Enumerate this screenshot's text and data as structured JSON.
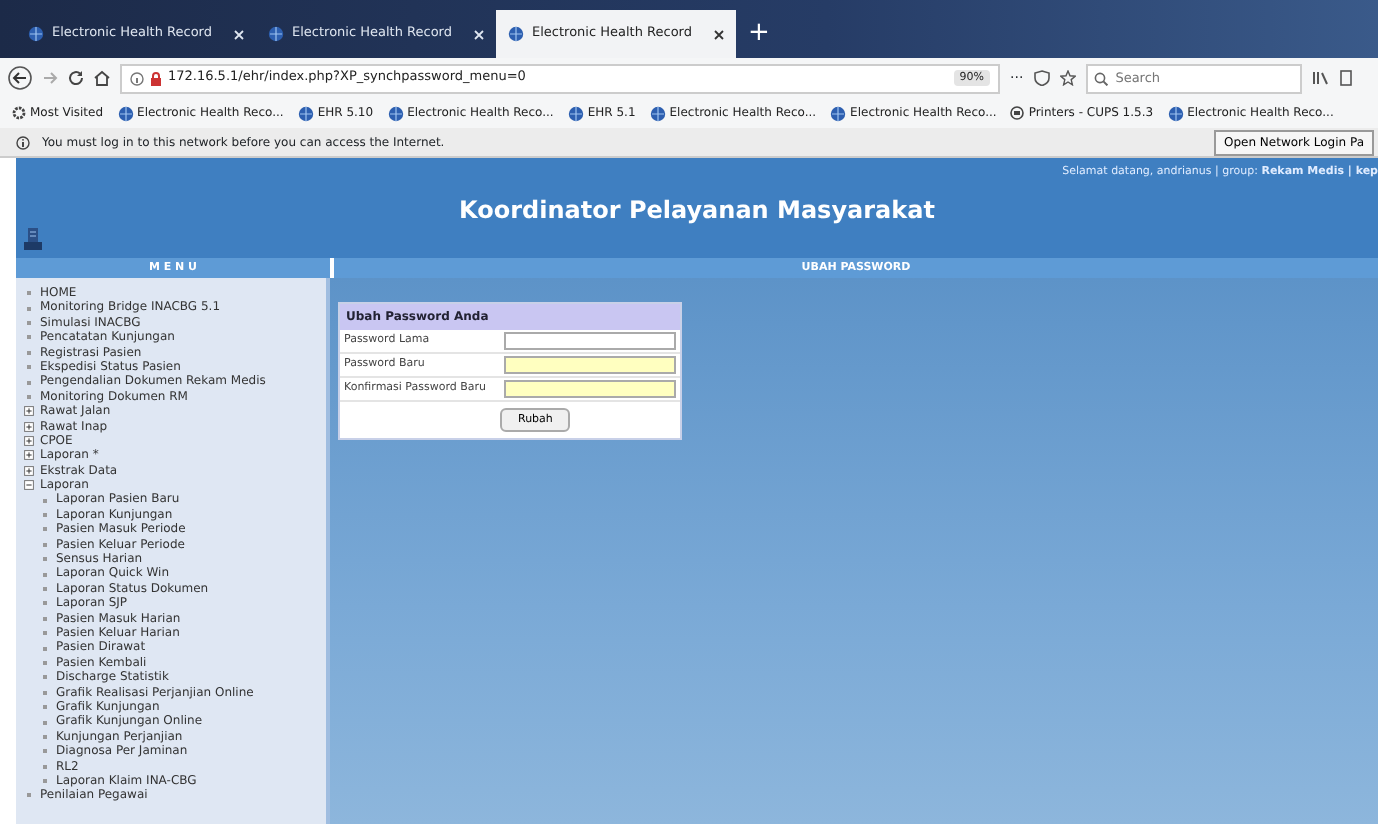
{
  "browser": {
    "tabs": [
      {
        "label": "Electronic Health Record",
        "selected": false
      },
      {
        "label": "Electronic Health Record",
        "selected": false
      },
      {
        "label": "Electronic Health Record",
        "selected": true
      }
    ],
    "new_tab": "+",
    "address": "172.16.5.1/ehr/index.php?XP_synchpassword_menu=0",
    "zoom": "90%",
    "more": "···",
    "search": {
      "placeholder": "Search"
    },
    "bookmarks": [
      {
        "label": "Most Visited",
        "kind": "gear"
      },
      {
        "label": "Electronic Health Reco...",
        "kind": "globe"
      },
      {
        "label": "EHR 5.10",
        "kind": "globe"
      },
      {
        "label": "Electronic Health Reco...",
        "kind": "globe"
      },
      {
        "label": "EHR 5.1",
        "kind": "globe"
      },
      {
        "label": "Electronic Health Reco...",
        "kind": "globe"
      },
      {
        "label": "Electronic Health Reco...",
        "kind": "globe"
      },
      {
        "label": "Printers - CUPS 1.5.3",
        "kind": "printer"
      },
      {
        "label": "Electronic Health Reco...",
        "kind": "globe"
      }
    ],
    "notification": {
      "text": "You must log in to this network before you can access the Internet.",
      "button": "Open Network Login Pa"
    }
  },
  "header": {
    "title": "Koordinator Pelayanan Masyarakat",
    "welcome": "Selamat datang, andrianus | group: **Rekam Medis | kep**"
  },
  "menu": {
    "title": "M E N U",
    "items": [
      {
        "label": "HOME",
        "kind": "link"
      },
      {
        "label": "Monitoring Bridge INACBG 5.1",
        "kind": "link"
      },
      {
        "label": "Simulasi INACBG",
        "kind": "link"
      },
      {
        "label": "Pencatatan Kunjungan",
        "kind": "link"
      },
      {
        "label": "Registrasi Pasien",
        "kind": "link"
      },
      {
        "label": "Ekspedisi Status Pasien",
        "kind": "link"
      },
      {
        "label": "Pengendalian Dokumen Rekam Medis",
        "kind": "link"
      },
      {
        "label": "Monitoring Dokumen RM",
        "kind": "link"
      },
      {
        "label": "Rawat Jalan",
        "kind": "folder",
        "expanded": false
      },
      {
        "label": "Rawat Inap",
        "kind": "folder",
        "expanded": false
      },
      {
        "label": "CPOE",
        "kind": "folder",
        "expanded": false
      },
      {
        "label": "Laporan *",
        "kind": "folder",
        "expanded": false
      },
      {
        "label": "Ekstrak Data",
        "kind": "folder",
        "expanded": false
      },
      {
        "label": "Laporan",
        "kind": "folder",
        "expanded": true,
        "children": [
          {
            "label": "Laporan Pasien Baru",
            "kind": "link"
          },
          {
            "label": "Laporan Kunjungan",
            "kind": "link"
          },
          {
            "label": "Pasien Masuk Periode",
            "kind": "link"
          },
          {
            "label": "Pasien Keluar Periode",
            "kind": "link"
          },
          {
            "label": "Sensus Harian",
            "kind": "link"
          },
          {
            "label": "Laporan Quick Win",
            "kind": "link"
          },
          {
            "label": "Laporan Status Dokumen",
            "kind": "link"
          },
          {
            "label": "Laporan SJP",
            "kind": "link"
          },
          {
            "label": "Pasien Masuk Harian",
            "kind": "link"
          },
          {
            "label": "Pasien Keluar Harian",
            "kind": "link"
          },
          {
            "label": "Pasien Dirawat",
            "kind": "link"
          },
          {
            "label": "Pasien Kembali",
            "kind": "link"
          },
          {
            "label": "Discharge Statistik",
            "kind": "link"
          },
          {
            "label": "Grafik Realisasi Perjanjian Online",
            "kind": "link"
          },
          {
            "label": "Grafik Kunjungan",
            "kind": "link"
          },
          {
            "label": "Grafik Kunjungan Online",
            "kind": "link"
          },
          {
            "label": "Kunjungan Perjanjian",
            "kind": "link"
          },
          {
            "label": "Diagnosa Per Jaminan",
            "kind": "link"
          },
          {
            "label": "RL2",
            "kind": "link"
          },
          {
            "label": "Laporan Klaim INA-CBG",
            "kind": "link"
          }
        ]
      },
      {
        "label": "Penilaian Pegawai",
        "kind": "link"
      }
    ]
  },
  "content": {
    "title": "UBAH PASSWORD",
    "form": {
      "title": "Ubah Password Anda",
      "fields": [
        {
          "label": "Password Lama",
          "highlighted": false
        },
        {
          "label": "Password Baru",
          "highlighted": true
        },
        {
          "label": "Konfirmasi Password Baru",
          "highlighted": true
        }
      ],
      "button": "Rubah"
    }
  }
}
